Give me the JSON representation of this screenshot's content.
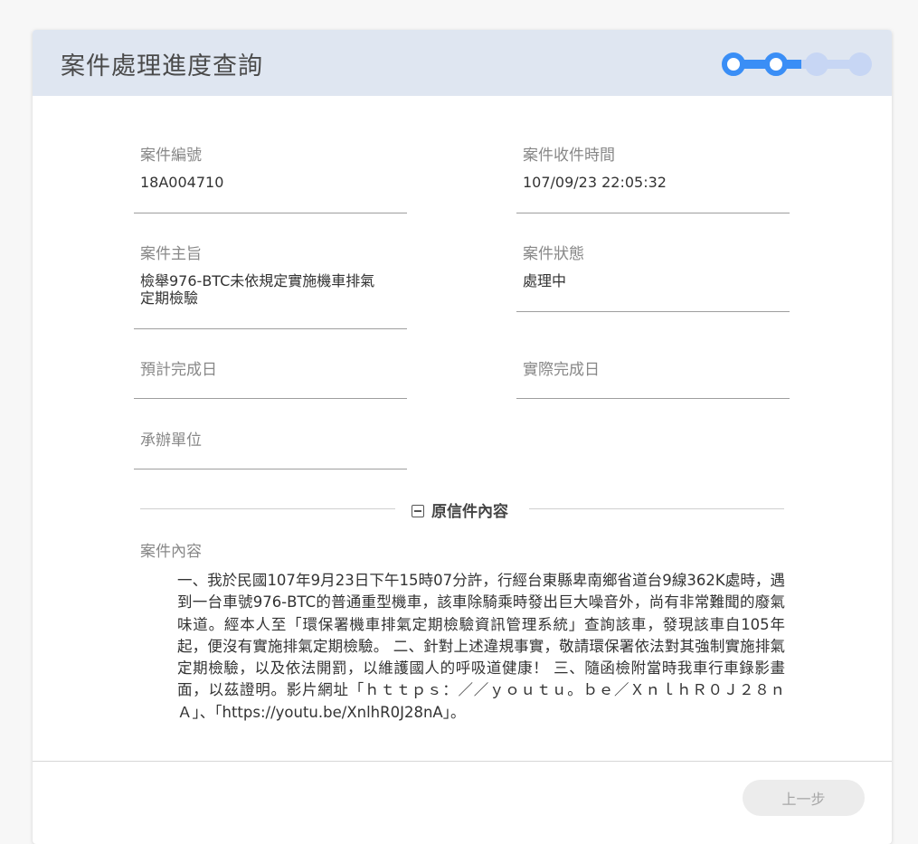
{
  "header": {
    "title": "案件處理進度查詢",
    "stepper": {
      "total_steps": 4,
      "completed_steps": 2,
      "active_color": "#3a8ef6",
      "inactive_color": "#c7d6f4"
    }
  },
  "fields": {
    "case_number": {
      "label": "案件編號",
      "value": "18A004710"
    },
    "received_time": {
      "label": "案件收件時間",
      "value": "107/09/23 22:05:32"
    },
    "subject": {
      "label": "案件主旨",
      "value_line1": "檢舉976-BTC未依規定實施機車排氣",
      "value_line2": "定期檢驗"
    },
    "status": {
      "label": "案件狀態",
      "value": "處理中"
    },
    "expected_completion": {
      "label": "預計完成日",
      "value": ""
    },
    "actual_completion": {
      "label": "實際完成日",
      "value": ""
    },
    "handling_unit": {
      "label": "承辦單位",
      "value": ""
    }
  },
  "original_letter": {
    "section_title": "原信件內容",
    "content_label": "案件內容",
    "content": "一、我於民國107年9月23日下午15時07分許，行經台東縣卑南鄉省道台9線362K處時，遇到一台車號976-BTC的普通重型機車，該車除騎乘時發出巨大噪音外，尚有非常難聞的廢氣味道。經本人至「環保署機車排氣定期檢驗資訊管理系統」查詢該車，發現該車自105年起，便沒有實施排氣定期檢驗。 二、針對上述違規事實，敬請環保署依法對其強制實施排氣定期檢驗，以及依法開罰，以維護國人的呼吸道健康！ 三、隨函檢附當時我車行車錄影畫面，以茲證明。影片網址「ｈｔｔｐｓ：／／ｙｏｕｔｕ。ｂｅ／ＸｎｌｈＲ０Ｊ２８ｎＡ」、「https://youtu.be/XnlhR0J28nA」。"
  },
  "footer": {
    "prev_button": "上一步"
  }
}
